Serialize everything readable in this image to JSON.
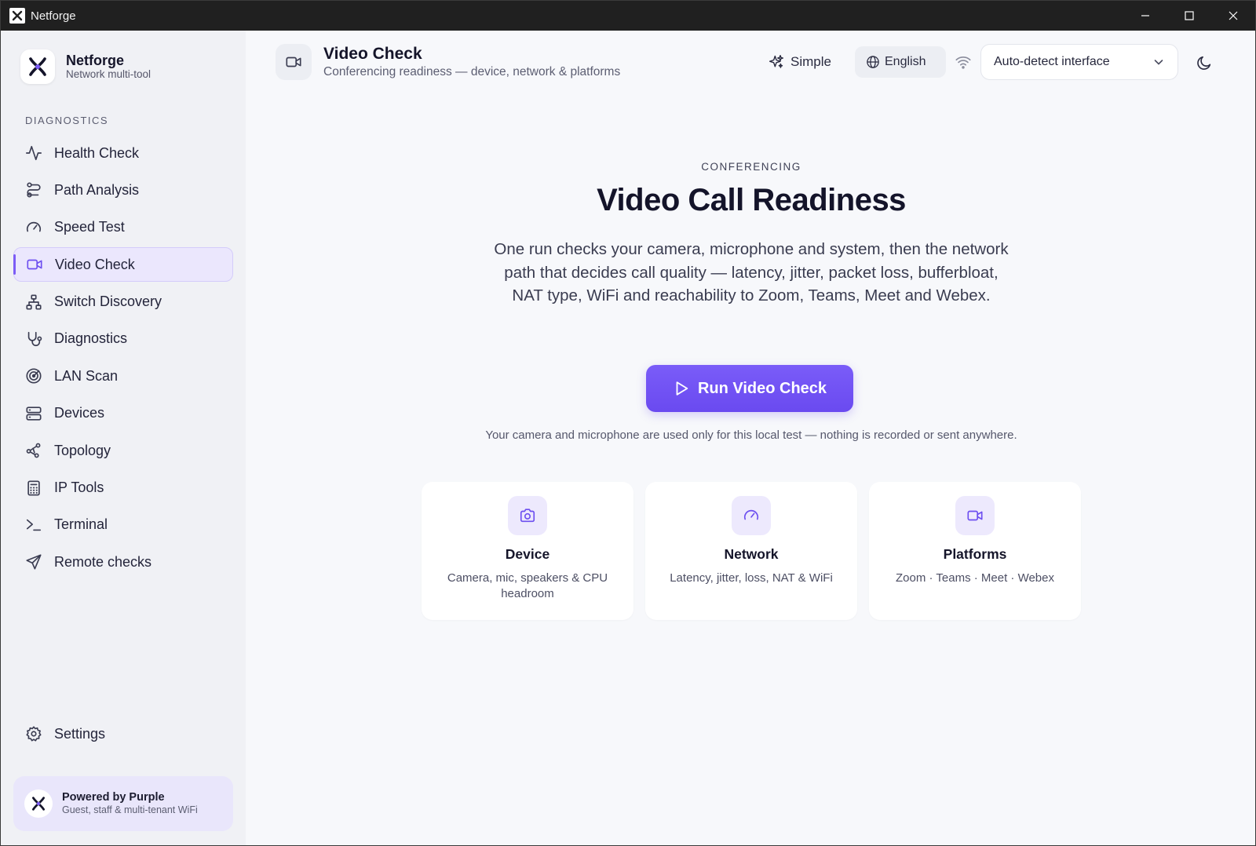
{
  "window": {
    "title": "Netforge"
  },
  "brand": {
    "name": "Netforge",
    "tagline": "Network multi-tool"
  },
  "sidebar": {
    "section_label": "DIAGNOSTICS",
    "items": [
      {
        "label": "Health Check",
        "icon": "activity-icon"
      },
      {
        "label": "Path Analysis",
        "icon": "route-icon"
      },
      {
        "label": "Speed Test",
        "icon": "gauge-icon"
      },
      {
        "label": "Video Check",
        "icon": "video-icon",
        "active": true
      },
      {
        "label": "Switch Discovery",
        "icon": "network-tree-icon"
      },
      {
        "label": "Diagnostics",
        "icon": "stethoscope-icon"
      },
      {
        "label": "LAN Scan",
        "icon": "radar-icon"
      },
      {
        "label": "Devices",
        "icon": "server-icon"
      },
      {
        "label": "Topology",
        "icon": "topology-icon"
      },
      {
        "label": "IP Tools",
        "icon": "calculator-icon"
      },
      {
        "label": "Terminal",
        "icon": "terminal-icon"
      },
      {
        "label": "Remote checks",
        "icon": "send-icon"
      }
    ],
    "settings_label": "Settings",
    "promo": {
      "title": "Powered by Purple",
      "subtitle": "Guest, staff & multi-tenant WiFi"
    }
  },
  "header": {
    "title": "Video Check",
    "subtitle": "Conferencing readiness — device, network & platforms",
    "simple_label": "Simple",
    "language": "English",
    "interface_selected": "Auto-detect interface"
  },
  "main": {
    "eyebrow": "CONFERENCING",
    "title": "Video Call Readiness",
    "description": "One run checks your camera, microphone and system, then the network path that decides call quality — latency, jitter, packet loss, bufferbloat, NAT type, WiFi and reachability to Zoom, Teams, Meet and Webex.",
    "run_label": "Run Video Check",
    "privacy_note": "Your camera and microphone are used only for this local test — nothing is recorded or sent anywhere.",
    "cards": [
      {
        "title": "Device",
        "desc": "Camera, mic, speakers & CPU headroom",
        "icon": "camera-icon"
      },
      {
        "title": "Network",
        "desc": "Latency, jitter, loss, NAT & WiFi",
        "icon": "gauge-icon"
      },
      {
        "title": "Platforms",
        "desc": "Zoom · Teams · Meet · Webex",
        "icon": "video-icon"
      }
    ]
  },
  "colors": {
    "accent": "#6d4ff0",
    "accent_light": "#ede9fd",
    "sidebar_bg": "#f0f1f5",
    "main_bg": "#f7f8fb"
  }
}
